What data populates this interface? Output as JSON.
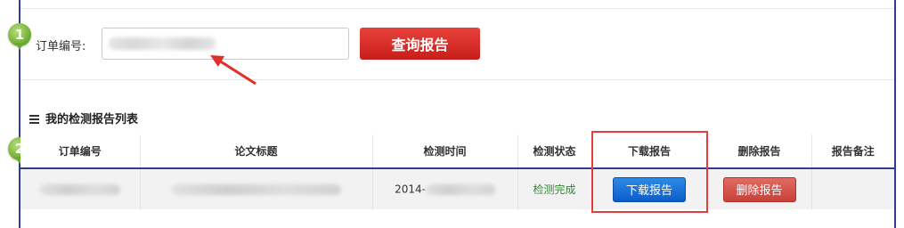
{
  "steps": {
    "one": "1",
    "two": "2"
  },
  "search": {
    "label": "订单编号:",
    "placeholder": "",
    "button_label": "查询报告"
  },
  "list": {
    "title": "我的检测报告列表"
  },
  "table": {
    "headers": {
      "order_no": "订单编号",
      "paper_title": "论文标题",
      "check_time": "检测时间",
      "status": "检测状态",
      "download": "下载报告",
      "delete": "删除报告",
      "remark": "报告备注"
    },
    "rows": [
      {
        "order_no": "",
        "paper_title": "",
        "check_time": "2014-",
        "status": "检测完成",
        "download_label": "下载报告",
        "delete_label": "删除报告",
        "remark": ""
      }
    ]
  },
  "colors": {
    "frame": "#2f3d8f",
    "accent_red": "#d02a24",
    "download_blue": "#0c5cc9",
    "step_green": "#6aa82e",
    "status_green": "#2f8a2f",
    "highlight_box": "#e53c3c"
  },
  "icons": {
    "list_icon": "list-icon",
    "annotation_arrow": "red-arrow-icon"
  }
}
